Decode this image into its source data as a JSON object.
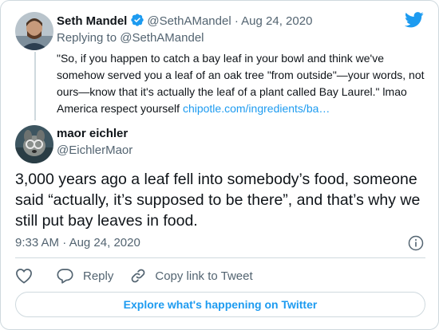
{
  "quoted_tweet": {
    "author_name": "Seth Mandel",
    "handle": "@SethAMandel",
    "separator": "·",
    "date": "Aug 24, 2020",
    "replying_label": "Replying to",
    "replying_handle": "@SethAMandel",
    "text": "\"So, if you happen to catch a bay leaf in your bowl and think we've somehow served you a leaf of an oak tree \"from outside\"—your words, not ours—know that it's actually the leaf of a plant called Bay Laurel.\" lmao America respect yourself ",
    "link_text": "chipotle.com/ingredients/ba…",
    "verified_icon": "verified-badge-icon"
  },
  "tweet": {
    "author_name": "maor eichler",
    "handle": "@EichlerMaor",
    "text": "3,000 years ago a leaf fell into somebody’s food, someone said “actually, it’s supposed to be there”, and that’s why we still put bay leaves in food.",
    "time": "9:33 AM",
    "separator": "·",
    "date": "Aug 24, 2020"
  },
  "actions": {
    "like_icon": "heart-icon",
    "reply_label": "Reply",
    "copy_link_label": "Copy link to Tweet"
  },
  "explore_button_label": "Explore what's happening on Twitter",
  "colors": {
    "twitter_blue": "#1d9bf0",
    "text_primary": "#0f1419",
    "text_secondary": "#536471",
    "border": "#cfd9de"
  }
}
